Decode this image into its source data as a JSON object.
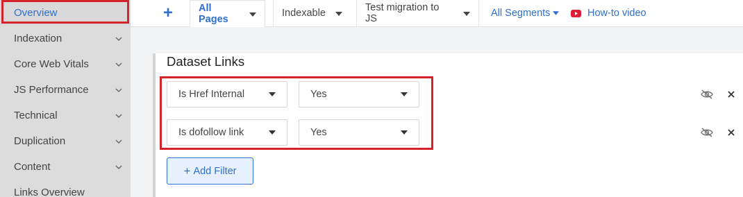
{
  "sidebar": {
    "items": [
      {
        "label": "Overview",
        "active": true,
        "expandable": false
      },
      {
        "label": "Indexation",
        "active": false,
        "expandable": true
      },
      {
        "label": "Core Web Vitals",
        "active": false,
        "expandable": true
      },
      {
        "label": "JS Performance",
        "active": false,
        "expandable": true
      },
      {
        "label": "Technical",
        "active": false,
        "expandable": true
      },
      {
        "label": "Duplication",
        "active": false,
        "expandable": true
      },
      {
        "label": "Content",
        "active": false,
        "expandable": true
      },
      {
        "label": "Links Overview",
        "active": false,
        "expandable": false
      }
    ]
  },
  "topbar": {
    "add_label": "+",
    "tabs": [
      {
        "label": "All Pages",
        "selected": true
      },
      {
        "label": "Indexable",
        "selected": false
      },
      {
        "label": "Test migration to JS",
        "selected": false
      }
    ],
    "segments_label": "All Segments",
    "howto_label": "How-to video"
  },
  "card": {
    "title": "Dataset Links",
    "filters": [
      {
        "field": "Is Href Internal",
        "value": "Yes"
      },
      {
        "field": "Is dofollow link",
        "value": "Yes"
      }
    ],
    "add_filter_label": "Add Filter"
  },
  "colors": {
    "accent": "#2f6fd1",
    "highlight": "#d5232b",
    "youtube": "#e01e37",
    "sidebar_bg": "#dcdcdc"
  }
}
